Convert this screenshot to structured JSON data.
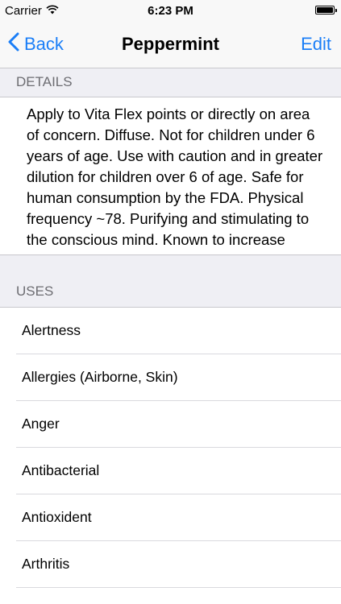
{
  "status_bar": {
    "carrier": "Carrier",
    "wifi_icon": "wifi-icon",
    "time": "6:23 PM",
    "battery_icon": "battery-icon"
  },
  "nav": {
    "back_label": "Back",
    "back_icon": "chevron-left-icon",
    "title": "Peppermint",
    "edit_label": "Edit",
    "accent_color": "#1a7ef7"
  },
  "details": {
    "header": "DETAILS",
    "text": "Apply to Vita Flex points or directly on area of concern. Diffuse. Not for children under 6 years of age. Use with caution and in greater dilution for children over 6 of age. Safe for human consumption by the FDA. Physical frequency ~78. Purifying and stimulating to the conscious mind. Known to increase"
  },
  "uses": {
    "header": "USES",
    "items": [
      {
        "label": "Alertness"
      },
      {
        "label": "Allergies (Airborne, Skin)"
      },
      {
        "label": "Anger"
      },
      {
        "label": "Antibacterial"
      },
      {
        "label": "Antioxident"
      },
      {
        "label": "Arthritis"
      }
    ]
  }
}
